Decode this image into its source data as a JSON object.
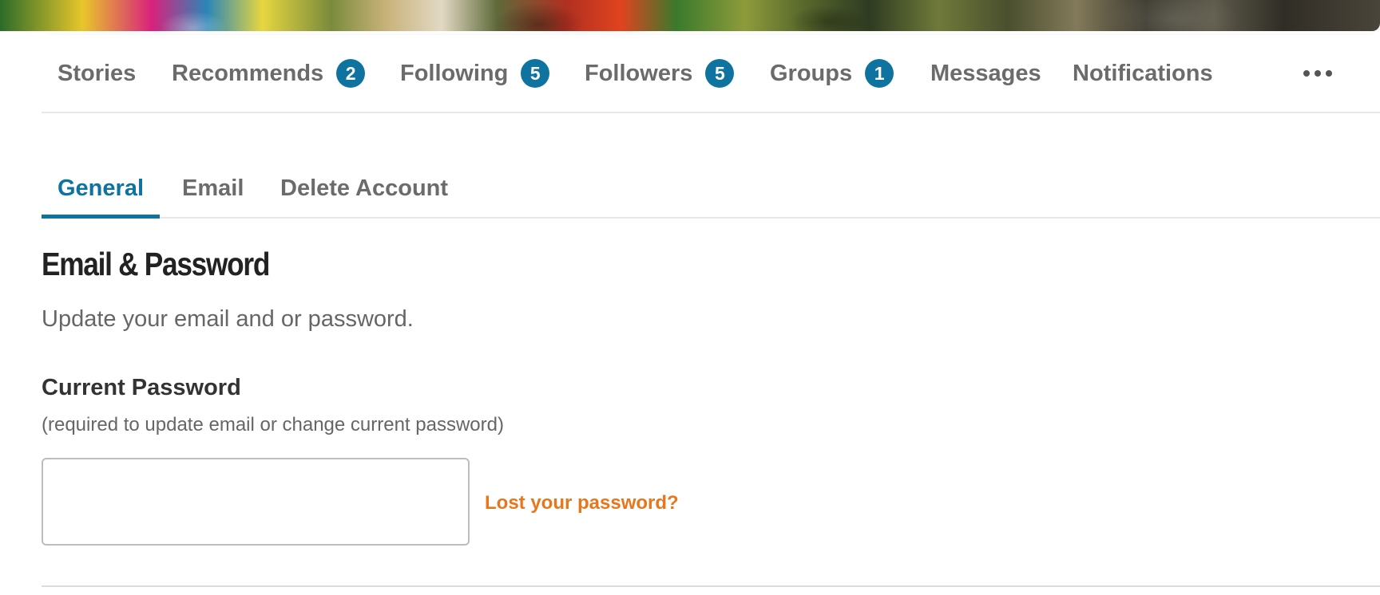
{
  "primary_nav": {
    "items": [
      {
        "label": "Stories",
        "badge": null
      },
      {
        "label": "Recommends",
        "badge": "2"
      },
      {
        "label": "Following",
        "badge": "5"
      },
      {
        "label": "Followers",
        "badge": "5"
      },
      {
        "label": "Groups",
        "badge": "1"
      },
      {
        "label": "Messages",
        "badge": null
      },
      {
        "label": "Notifications",
        "badge": null
      }
    ],
    "more_icon": "ellipsis-icon"
  },
  "settings_tabs": {
    "items": [
      {
        "label": "General",
        "active": true
      },
      {
        "label": "Email",
        "active": false
      },
      {
        "label": "Delete Account",
        "active": false
      }
    ]
  },
  "form": {
    "section_title": "Email & Password",
    "section_description": "Update your email and or password.",
    "current_password_label": "Current Password",
    "current_password_help": "(required to update email or change current password)",
    "current_password_value": "",
    "lost_password_link": "Lost your password?"
  },
  "colors": {
    "accent": "#0f73a0",
    "link": "#e8761c",
    "nav_text": "#6b6b6b"
  }
}
